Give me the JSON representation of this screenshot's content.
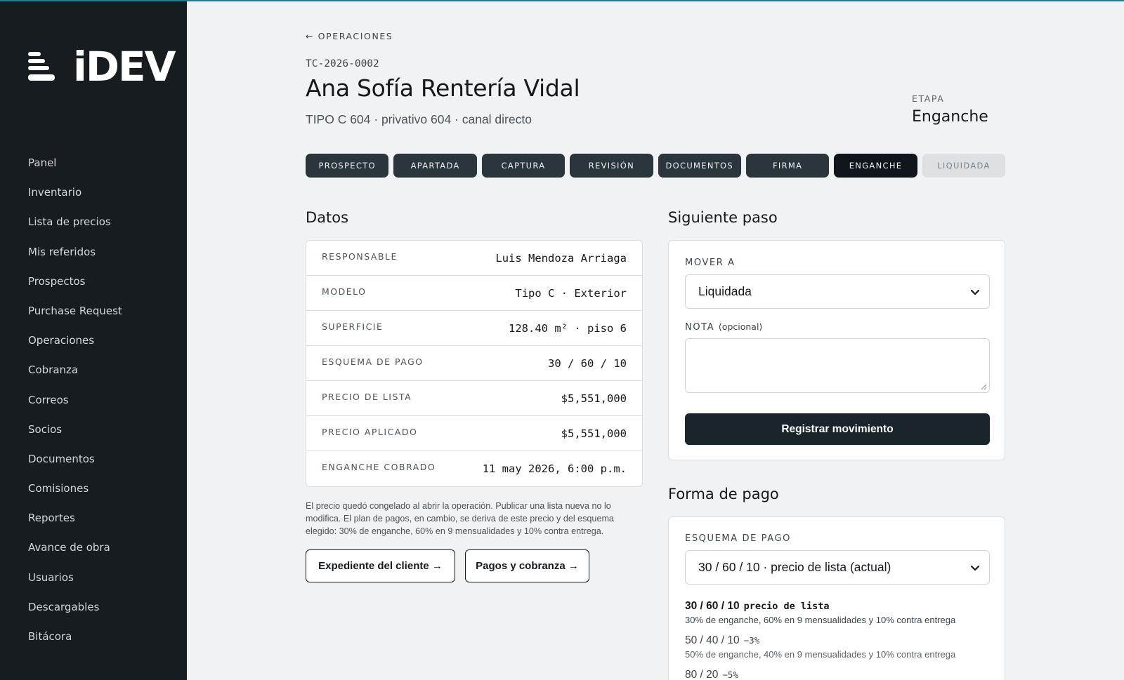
{
  "app": {
    "logo_text": "iDEV",
    "nav": [
      "Panel",
      "Inventario",
      "Lista de precios",
      "Mis referidos",
      "Prospectos",
      "Purchase Request",
      "Operaciones",
      "Cobranza",
      "Correos",
      "Socios",
      "Documentos",
      "Comisiones",
      "Reportes",
      "Avance de obra",
      "Usuarios",
      "Descargables",
      "Bitácora"
    ]
  },
  "header": {
    "back_label": "← OPERACIONES",
    "code": "TC-2026-0002",
    "client_name": "Ana Sofía Rentería Vidal",
    "subtitle": "TIPO C 604 · privativo 604 · canal directo",
    "stage_label": "ETAPA",
    "stage_value": "Enganche"
  },
  "stages": [
    {
      "label": "PROSPECTO",
      "state": "done"
    },
    {
      "label": "APARTADA",
      "state": "done"
    },
    {
      "label": "CAPTURA",
      "state": "done"
    },
    {
      "label": "REVISIÓN",
      "state": "done"
    },
    {
      "label": "DOCUMENTOS",
      "state": "done"
    },
    {
      "label": "FIRMA",
      "state": "done"
    },
    {
      "label": "ENGANCHE",
      "state": "current"
    },
    {
      "label": "LIQUIDADA",
      "state": "future"
    }
  ],
  "datos": {
    "title": "Datos",
    "rows": [
      {
        "key": "RESPONSABLE",
        "value": "Luis Mendoza Arriaga"
      },
      {
        "key": "MODELO",
        "value": "Tipo C · Exterior"
      },
      {
        "key": "SUPERFICIE",
        "value": "128.40 m² · piso 6"
      },
      {
        "key": "ESQUEMA DE PAGO",
        "value": "30 / 60 / 10"
      },
      {
        "key": "PRECIO DE LISTA",
        "value": "$5,551,000"
      },
      {
        "key": "PRECIO APLICADO",
        "value": "$5,551,000"
      },
      {
        "key": "ENGANCHE COBRADO",
        "value": "11 may 2026, 6:00 p.m."
      }
    ],
    "note": "El precio quedó congelado al abrir la operación. Publicar una lista nueva no lo modifica. El plan de pagos, en cambio, se deriva de este precio y del esquema elegido: 30% de enganche, 60% en 9 mensualidades y 10% contra entrega.",
    "btn_expediente": "Expediente del cliente →",
    "btn_pagos": "Pagos y cobranza →"
  },
  "siguiente": {
    "title": "Siguiente paso",
    "mover_label": "MOVER A",
    "mover_value": "Liquidada",
    "nota_label": "NOTA",
    "nota_optional": "(opcional)",
    "submit_label": "Registrar movimiento"
  },
  "forma_pago": {
    "title": "Forma de pago",
    "esquema_label": "ESQUEMA DE PAGO",
    "esquema_value": "30 / 60 / 10 · precio de lista (actual)",
    "plans": [
      {
        "title": "30 / 60 / 10",
        "tag": "precio de lista",
        "desc": "30% de enganche, 60% en 9 mensualidades y 10% contra entrega"
      },
      {
        "title": "50 / 40 / 10",
        "tag": "−3%",
        "desc": "50% de enganche, 40% en 9 mensualidades y 10% contra entrega"
      },
      {
        "title": "80 / 20",
        "tag": "−5%",
        "desc": ""
      }
    ]
  },
  "colors": {
    "sidebar_bg": "#161c20",
    "accent_line": "#2b7a85",
    "stage_done": "#2a353c",
    "stage_current": "#0f151a",
    "stage_future": "#dde1e4",
    "primary_button": "#1a242b"
  }
}
